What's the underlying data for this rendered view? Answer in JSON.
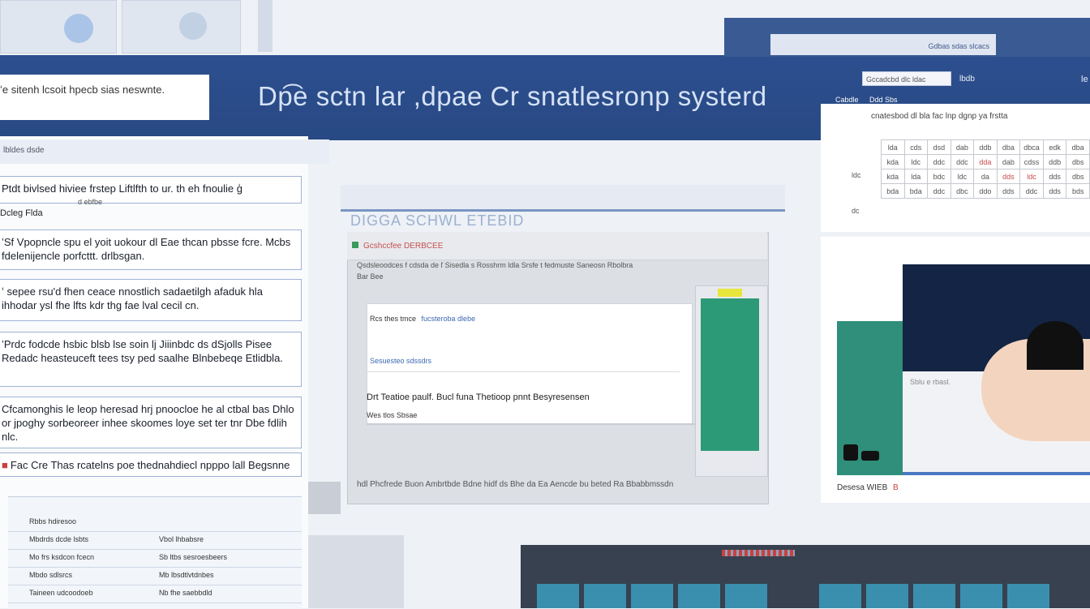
{
  "header": {
    "title": "Dp͡e sctn lar  ,dpae  Cr snatlesronp systerd",
    "search_text": "ʻe sitenh  lcsoit hpecb sias neswnte."
  },
  "right_header": {
    "tab_text": "Gdbas sdas slcacs",
    "search_text": "Gccadcbd dlc ldac",
    "link1": "lbdb",
    "link2": "le",
    "sub1": "Cabdle",
    "sub2": "Ddd Sbs",
    "sheet_heading": "cnatesbod dl bla fac lnp dgnp ya frstta"
  },
  "sheet": {
    "rows": [
      [
        "lda",
        "cds",
        "dsd",
        "dab",
        "ddb",
        "dba",
        "dbca",
        "edk",
        "dba"
      ],
      [
        "kda",
        "ldc",
        "ddc",
        "ddc",
        "dda",
        "dab",
        "cdss",
        "ddb",
        "dbs"
      ],
      [
        "kda",
        "lda",
        "bdc",
        "ldc",
        "da",
        "dds",
        "ldc",
        "dds",
        "dbs"
      ],
      [
        "bda",
        "bda",
        "ddc",
        "dbc",
        "ddo",
        "dds",
        "ddc",
        "dds",
        "bds"
      ]
    ],
    "row_numbers": [
      "ldc",
      "dc"
    ]
  },
  "left_panel": {
    "head_text": "lbldes dsde",
    "label": "Dcleg  Flda",
    "cards": [
      {
        "text": "Ptdt bivlsed hiviee  frstep Liftlfth to ur. th eh fnoulie ģ",
        "sub": "d ebfbe"
      },
      {
        "text": "ʻSf Vpopncle spu el yoit uokour dl  Eae  thcan pbsse fcre. Mcbs  fdelenijencle porfcttt.                    drlbsgan."
      },
      {
        "text": "ʻ sepee rsu'd fhen  ceace nnostlich sadaetilgh afaduk hla ihhodar ysl fhe lfts kdr thg fae lval cecil cn."
      },
      {
        "text": "ʻPrdc fodcde hsbic blsb lse soin lj Jiiinbdc ds dSjolls Pisee Redadc   heasteuceft tees tsy ped saalhe Blnbebeqe Etlidbla."
      },
      {
        "text": "Cfcamonghis le leop heresad hrj pnoocloe he al ctbal bas Dhlo or jpoghy sorbeoreer inhee skoomes loye set ter tnr Dbe fdlih nlc."
      },
      {
        "text": "Fac Cre Thas rcatelns poe thednahdiecl npppo lall Begsnne"
      }
    ],
    "table_rows": [
      [
        "Rbbs hdiresoo",
        ""
      ],
      [
        "Mbdrds dcde lsbts",
        "Vbol lhbabsre"
      ],
      [
        "Mo frs ksdcon fcecn",
        "Sb ltbs sesroesbeers"
      ],
      [
        "Mbdo sdlsrcs",
        "Mb lbsdtlvtdnbes"
      ],
      [
        "Taineen udcoodoeb",
        "Nb fhe saebbdld"
      ]
    ]
  },
  "center": {
    "title": "DIGGA SCHWL ETEBID",
    "window_title": "Gcshccfee  DERBCEE",
    "columns": "Qsdsleoodces f  cdsda de  ľ Sisedla  s  Rosshrm ldla  Srsfe t  fedmuste  Saneosn  Rbolbra",
    "col2": "Bar Bee",
    "body_line1": "Rcs  thes tmce",
    "body_link1": "fucsteroba dlebe",
    "body_link2": "Sesuesteo  sdssdrs",
    "body_line2": "Drt Teatioe paulf.  Bucl funa Thetioop pnnt  Besyresensen",
    "body_line3": "Wes tlos  Sbsae",
    "footer": "hdl Phcfrede  Buon  Ambrtbde    Bdne hidf ds  Bhe da    Ea  Aencde bu beted         Ra Bbabbmssdn"
  },
  "image_panel": {
    "caption": "Sblu e rbasl.",
    "footer_label": "Desesa WIEB",
    "footer_badge": "B"
  },
  "colors": {
    "header_blue": "#2d4f8f",
    "accent_green": "#2d9a77",
    "device_dark": "#37414f",
    "key_teal": "#3b8fae"
  }
}
